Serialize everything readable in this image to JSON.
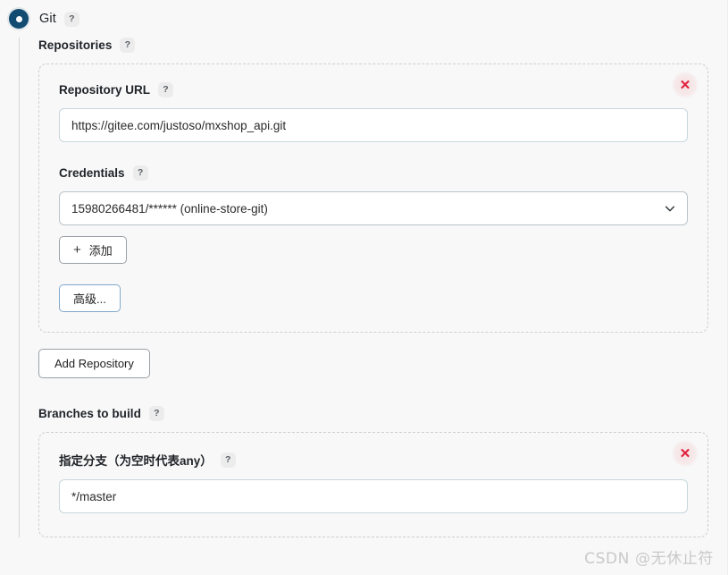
{
  "scm": {
    "selected_label": "Git",
    "radio_state": "selected",
    "help_glyph": "?"
  },
  "repositories": {
    "section_label": "Repositories",
    "repo": {
      "url_label": "Repository URL",
      "url_value": "https://gitee.com/justoso/mxshop_api.git",
      "credentials_label": "Credentials",
      "credentials_value": "15980266481/****** (online-store-git)",
      "add_credential_button": "添加",
      "add_credential_plus": "+",
      "advanced_button": "高级...",
      "delete_glyph": "✕"
    },
    "add_repository_button": "Add Repository"
  },
  "branches": {
    "section_label": "Branches to build",
    "branch": {
      "spec_label": "指定分支（为空时代表any）",
      "spec_value": "*/master",
      "delete_glyph": "✕"
    }
  },
  "watermark": "CSDN @无休止符",
  "colors": {
    "radio_fill": "#124b72",
    "delete_red": "#e01e3c",
    "dashed_border": "#cfcfcf",
    "input_border": "#c7d6de",
    "advanced_border": "#7fa8cc",
    "page_bg": "#f8f8f8"
  }
}
